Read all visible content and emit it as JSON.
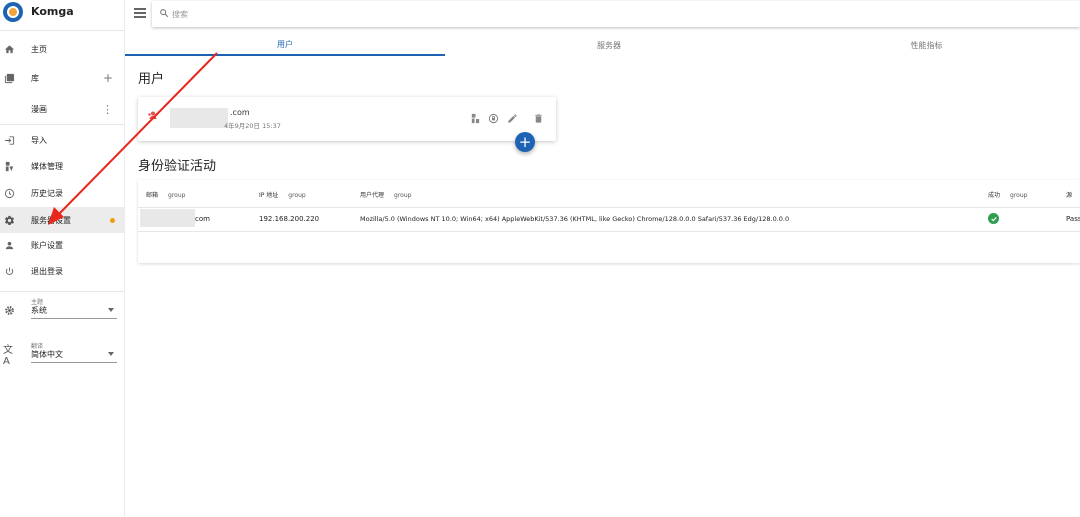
{
  "app": {
    "name": "Komga"
  },
  "search": {
    "placeholder": "搜索"
  },
  "sidebar": {
    "items": [
      {
        "label": "主页",
        "icon": "home-icon"
      },
      {
        "label": "库",
        "icon": "library-icon",
        "action": "+"
      },
      {
        "label": "漫画",
        "icon": "",
        "action": "⋮"
      },
      {
        "label": "导入",
        "icon": "import-icon"
      },
      {
        "label": "媒体管理",
        "icon": "media-management-icon"
      },
      {
        "label": "历史记录",
        "icon": "history-icon"
      },
      {
        "label": "服务器设置",
        "icon": "gear-icon",
        "active": true
      },
      {
        "label": "账户设置",
        "icon": "account-icon"
      },
      {
        "label": "退出登录",
        "icon": "power-icon"
      }
    ],
    "theme": {
      "caption": "主题",
      "value": "系统"
    },
    "language": {
      "caption": "翻译",
      "value": "简体中文"
    }
  },
  "tabs": [
    {
      "label": "用户",
      "active": true
    },
    {
      "label": "服务器"
    },
    {
      "label": "性能指标"
    }
  ],
  "users_section": {
    "title": "用户",
    "user": {
      "email_suffix": ".com",
      "date": "4年9月20日 15:37"
    },
    "add_label": "+"
  },
  "auth_section": {
    "title": "身份验证活动",
    "headers": {
      "email": "邮箱",
      "ip": "IP 地址",
      "agent": "用户代理",
      "success": "成功",
      "source": "源",
      "group": "group"
    },
    "row": {
      "email_suffix": "com",
      "ip": "192.168.200.220",
      "agent": "Mozilla/5.0 (Windows NT 10.0; Win64; x64) AppleWebKit/537.36 (KHTML, like Gecko) Chrome/128.0.0.0 Safari/537.36 Edg/128.0.0.0",
      "source": "Pass"
    }
  },
  "colors": {
    "accent": "#1e63b3",
    "success": "#2e9e4f",
    "annotation": "#e8261b",
    "badge": "#f39c12"
  }
}
